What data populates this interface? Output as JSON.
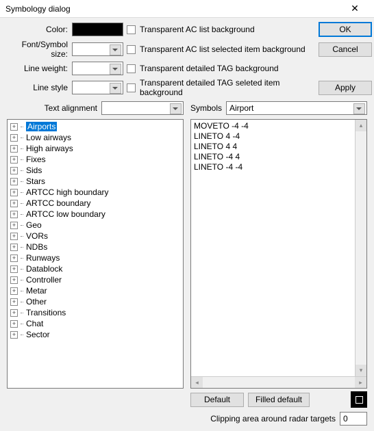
{
  "window": {
    "title": "Symbology dialog"
  },
  "labels": {
    "color": "Color:",
    "font_size": "Font/Symbol size:",
    "line_weight": "Line weight:",
    "line_style": "Line style",
    "text_align": "Text alignment",
    "symbols": "Symbols",
    "clipping": "Clipping area around radar targets"
  },
  "checkboxes": {
    "c1": "Transparent AC list background",
    "c2": "Transparent AC list selected item background",
    "c3": "Transparent detailed TAG background",
    "c4": "Transparent detailed TAG seleted item background"
  },
  "buttons": {
    "ok": "OK",
    "cancel": "Cancel",
    "apply": "Apply",
    "default": "Default",
    "filled": "Filled default"
  },
  "combos": {
    "symbol_selected": "Airport"
  },
  "tree": [
    "Airports",
    "Low airways",
    "High airways",
    "Fixes",
    "Sids",
    "Stars",
    "ARTCC high boundary",
    "ARTCC boundary",
    "ARTCC low boundary",
    "Geo",
    "VORs",
    "NDBs",
    "Runways",
    "Datablock",
    "Controller",
    "Metar",
    "Other",
    "Transitions",
    "Chat",
    "Sector"
  ],
  "code": [
    "MOVETO -4 -4",
    "LINETO 4 -4",
    "LINETO 4 4",
    "LINETO -4 4",
    "LINETO -4 -4"
  ],
  "clipping_value": "0"
}
